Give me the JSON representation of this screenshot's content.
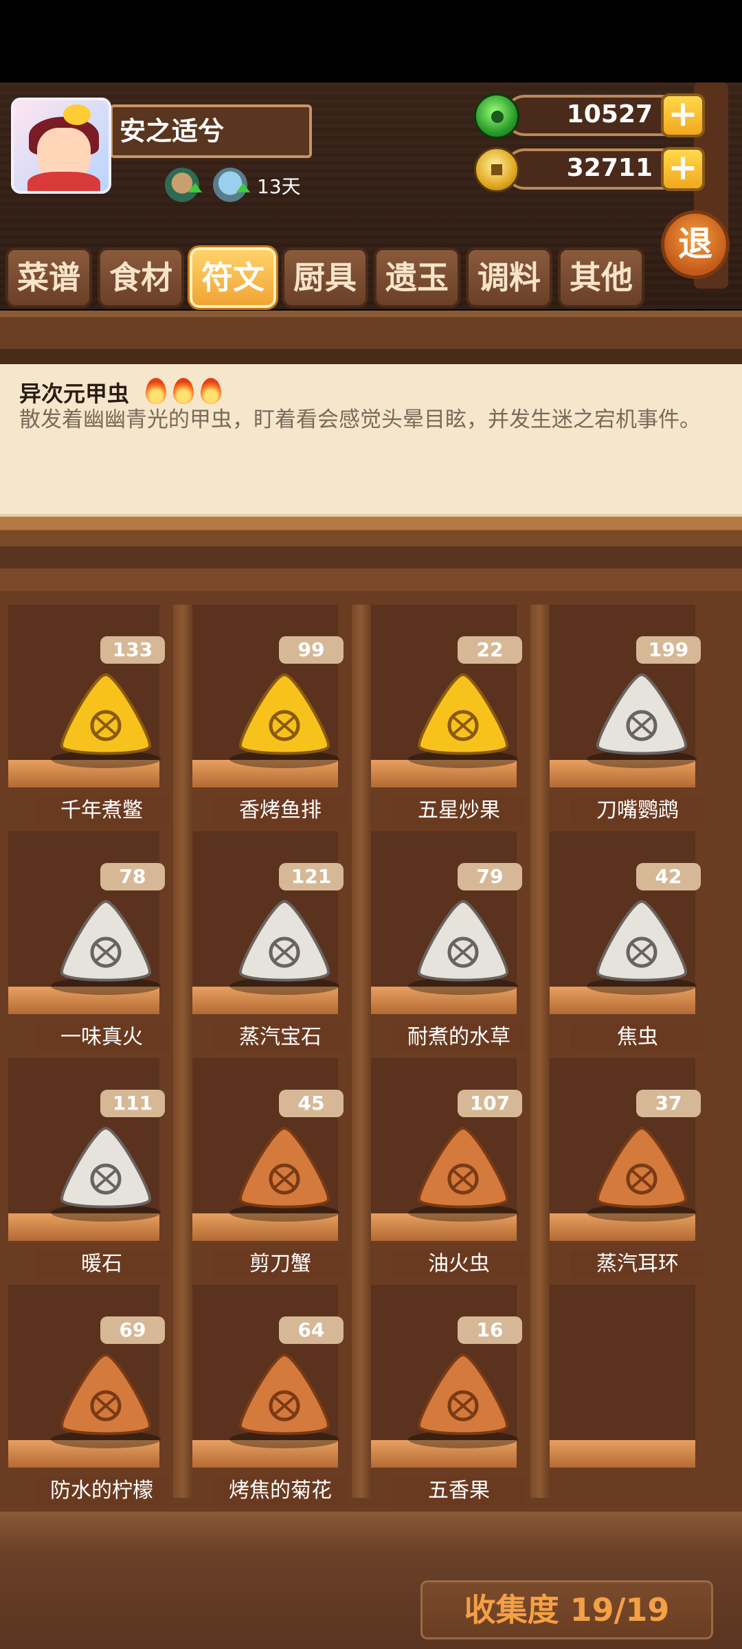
{
  "profile": {
    "name": "安之适兮",
    "days": "13天"
  },
  "currency": {
    "jade": "10527",
    "coins": "32711",
    "plus": "+"
  },
  "exit_label": "退",
  "tabs": [
    {
      "label": "菜谱",
      "active": false
    },
    {
      "label": "食材",
      "active": false
    },
    {
      "label": "符文",
      "active": true
    },
    {
      "label": "厨具",
      "active": false
    },
    {
      "label": "遗玉",
      "active": false
    },
    {
      "label": "调料",
      "active": false
    },
    {
      "label": "其他",
      "active": false
    }
  ],
  "description": {
    "title": "异次元甲虫",
    "text": "散发着幽幽青光的甲虫，盯着看会感觉头晕目眩，并发生迷之宕机事件。"
  },
  "colors": {
    "gold": "#f7c21c",
    "silver": "#e6e2dc",
    "copper": "#d47a3c"
  },
  "runes": [
    {
      "name": "千年煮鳖",
      "count": "133",
      "tier": "gold",
      "icon": "turtle-icon"
    },
    {
      "name": "香烤鱼排",
      "count": "99",
      "tier": "gold",
      "icon": "fish-icon"
    },
    {
      "name": "五星炒果",
      "count": "22",
      "tier": "gold",
      "icon": "star-icon"
    },
    {
      "name": "刀嘴鹦鹉",
      "count": "199",
      "tier": "silver",
      "icon": "parrot-icon"
    },
    {
      "name": "一味真火",
      "count": "78",
      "tier": "silver",
      "icon": "leaf-icon"
    },
    {
      "name": "蒸汽宝石",
      "count": "121",
      "tier": "silver",
      "icon": "spiral-icon"
    },
    {
      "name": "耐煮的水草",
      "count": "79",
      "tier": "silver",
      "icon": "seaweed-icon"
    },
    {
      "name": "焦虫",
      "count": "42",
      "tier": "silver",
      "icon": "bug-icon"
    },
    {
      "name": "暖石",
      "count": "111",
      "tier": "silver",
      "icon": "stone-icon"
    },
    {
      "name": "剪刀蟹",
      "count": "45",
      "tier": "copper",
      "icon": "crab-icon"
    },
    {
      "name": "油火虫",
      "count": "107",
      "tier": "copper",
      "icon": "snail-icon"
    },
    {
      "name": "蒸汽耳环",
      "count": "37",
      "tier": "copper",
      "icon": "earring-icon"
    },
    {
      "name": "防水的柠檬",
      "count": "69",
      "tier": "copper",
      "icon": "lemon-icon"
    },
    {
      "name": "烤焦的菊花",
      "count": "64",
      "tier": "copper",
      "icon": "flower-icon"
    },
    {
      "name": "五香果",
      "count": "16",
      "tier": "copper",
      "icon": "fruit-icon"
    }
  ],
  "collection": "收集度 19/19"
}
